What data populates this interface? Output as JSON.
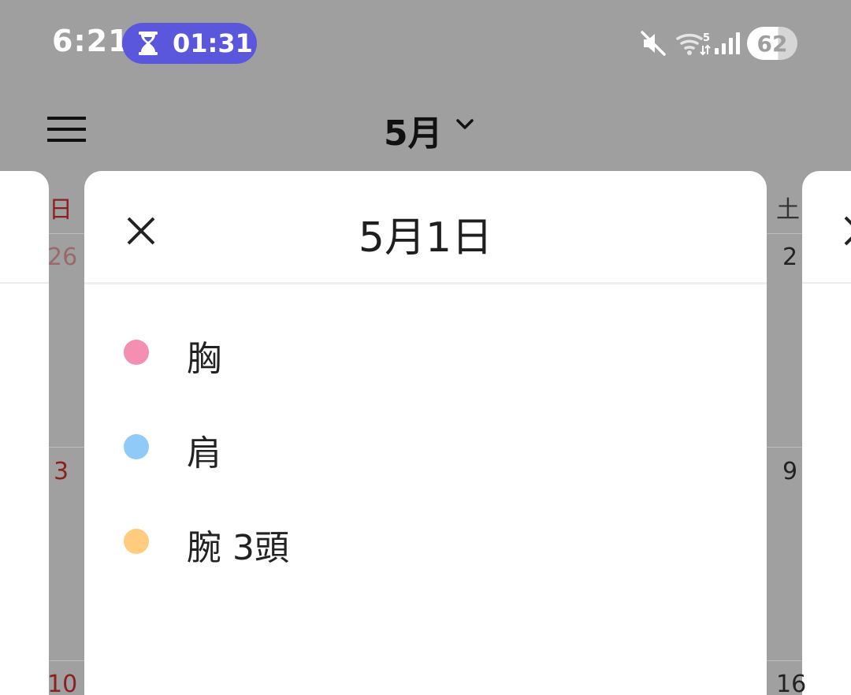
{
  "status_bar": {
    "time": "6:21",
    "timer": {
      "value": "01:31",
      "color": "#5b57dd"
    },
    "battery": "62",
    "icons": [
      "mute-icon",
      "wifi-icon",
      "signal-icon"
    ]
  },
  "app_bar": {
    "month_label": "5月",
    "icons": [
      "menu-icon",
      "chevron-down-icon"
    ]
  },
  "calendar": {
    "left_column": {
      "weekday": "日",
      "dates": [
        "26",
        "3",
        "10"
      ]
    },
    "right_column": {
      "weekday": "土",
      "dates": [
        "2",
        "9",
        "16"
      ]
    }
  },
  "day_sheet": {
    "date_title": "5月1日",
    "events": [
      {
        "label": "胸",
        "color": "#f48fb1"
      },
      {
        "label": "肩",
        "color": "#90caf9"
      },
      {
        "label": "腕 3頭",
        "color": "#ffcc80"
      }
    ]
  }
}
